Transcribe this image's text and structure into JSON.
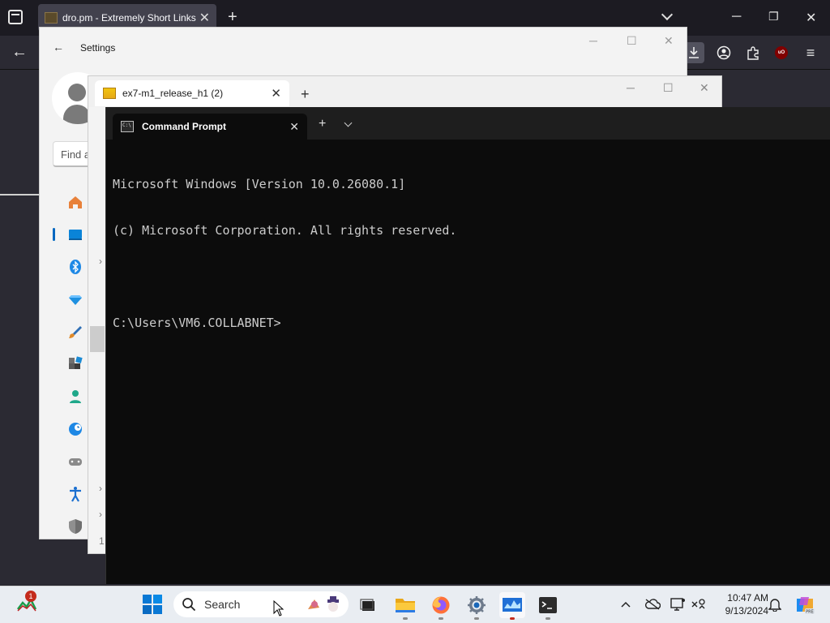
{
  "browser": {
    "tab_title": "dro.pm - Extremely Short Links",
    "close_glyph": "✕",
    "new_tab_glyph": "+",
    "back_glyph": "←"
  },
  "settings": {
    "title": "Settings",
    "back_glyph": "←",
    "search_placeholder": "Find a",
    "nav_items": [
      "home",
      "system",
      "bluetooth-devices",
      "network",
      "personalization",
      "apps",
      "accounts",
      "time-language",
      "gaming",
      "accessibility",
      "privacy-security"
    ]
  },
  "winrar": {
    "tab_title": "ex7-m1_release_h1 (2)",
    "close_glyph": "✕",
    "new_tab_glyph": "+",
    "side_marker": "1"
  },
  "cmd": {
    "tab_title": "Command Prompt",
    "close_glyph": "✕",
    "new_tab_glyph": "+",
    "lines": [
      "Microsoft Windows [Version 10.0.26080.1]",
      "(c) Microsoft Corporation. All rights reserved.",
      "",
      "C:\\Users\\VM6.COLLABNET>"
    ]
  },
  "taskbar": {
    "widget_badge": "1",
    "search_label": "Search",
    "time": "10:47 AM",
    "date": "9/13/2024",
    "apps": [
      "task-view",
      "file-explorer",
      "firefox",
      "settings",
      "winrar",
      "terminal"
    ]
  },
  "colors": {
    "terminal_bg": "#0c0c0c",
    "terminal_text": "#cccccc",
    "accent": "#0067c0",
    "badge_red": "#c42b1c"
  }
}
